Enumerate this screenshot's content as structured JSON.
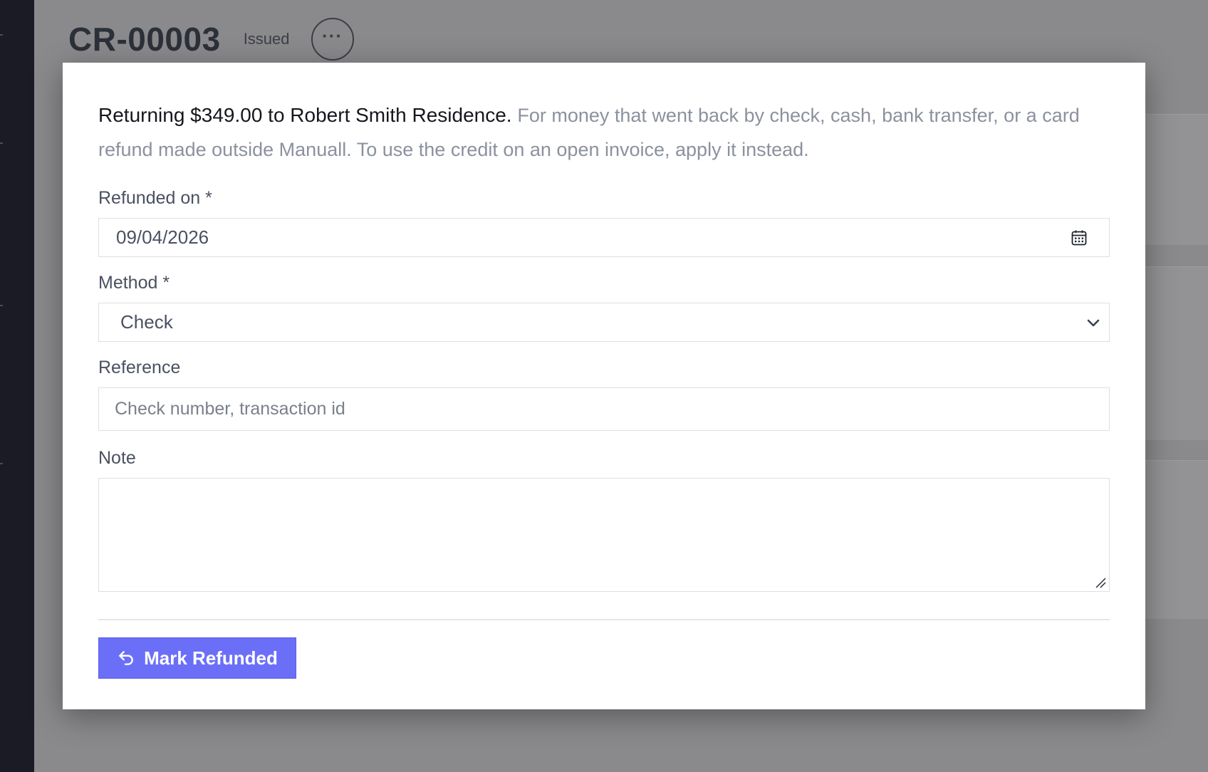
{
  "header": {
    "title": "CR-00003",
    "status": "Issued",
    "more_glyph": "···"
  },
  "modal": {
    "intro_strong": "Returning $349.00 to Robert Smith Residence.",
    "intro_muted": "For money that went back by check, cash, bank transfer, or a card refund made outside Manuall. To use the credit on an open invoice, apply it instead.",
    "refunded_on": {
      "label": "Refunded on *",
      "value": "09/04/2026"
    },
    "method": {
      "label": "Method *",
      "value": "Check"
    },
    "reference": {
      "label": "Reference",
      "placeholder": "Check number, transaction id"
    },
    "note": {
      "label": "Note",
      "value": ""
    },
    "submit_label": "Mark Refunded"
  },
  "colors": {
    "accent": "#6b6ff8",
    "overlay": "#8a8a8d",
    "sidebar": "#1a1b24"
  }
}
